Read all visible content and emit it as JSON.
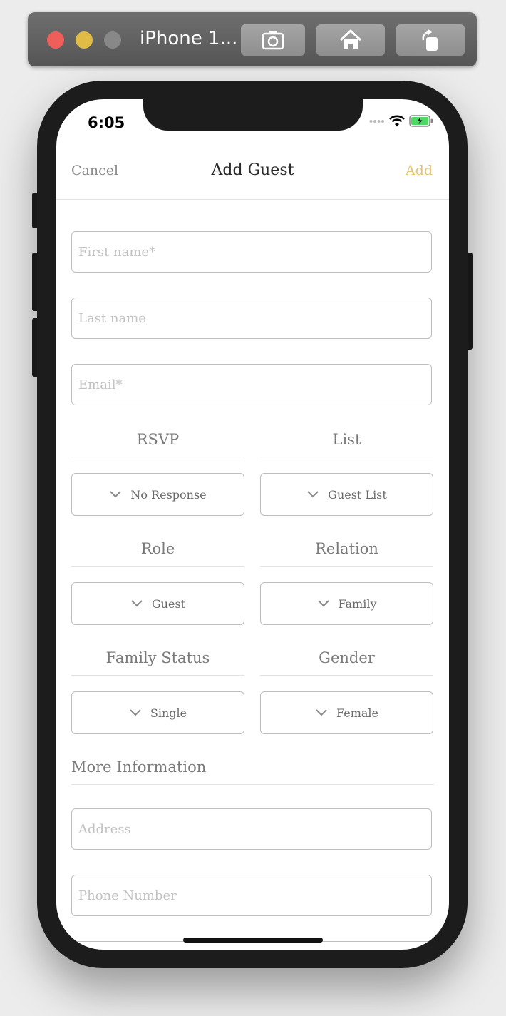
{
  "simulator": {
    "title": "iPhone 1..."
  },
  "status_bar": {
    "time": "6:05"
  },
  "nav": {
    "cancel": "Cancel",
    "title": "Add Guest",
    "add": "Add"
  },
  "form": {
    "first_name_placeholder": "First name*",
    "last_name_placeholder": "Last name",
    "email_placeholder": "Email*",
    "rsvp_label": "RSVP",
    "rsvp_value": "No Response",
    "list_label": "List",
    "list_value": "Guest List",
    "role_label": "Role",
    "role_value": "Guest",
    "relation_label": "Relation",
    "relation_value": "Family",
    "family_status_label": "Family Status",
    "family_status_value": "Single",
    "gender_label": "Gender",
    "gender_value": "Female",
    "more_info_label": "More Information",
    "address_placeholder": "Address",
    "phone_placeholder": "Phone Number"
  },
  "colors": {
    "accent": "#e3c36f",
    "battery_green": "#4cd964"
  },
  "icons": [
    "screenshot-icon",
    "home-icon",
    "rotate-icon",
    "wifi-icon",
    "battery-icon",
    "chevron-down-icon"
  ]
}
